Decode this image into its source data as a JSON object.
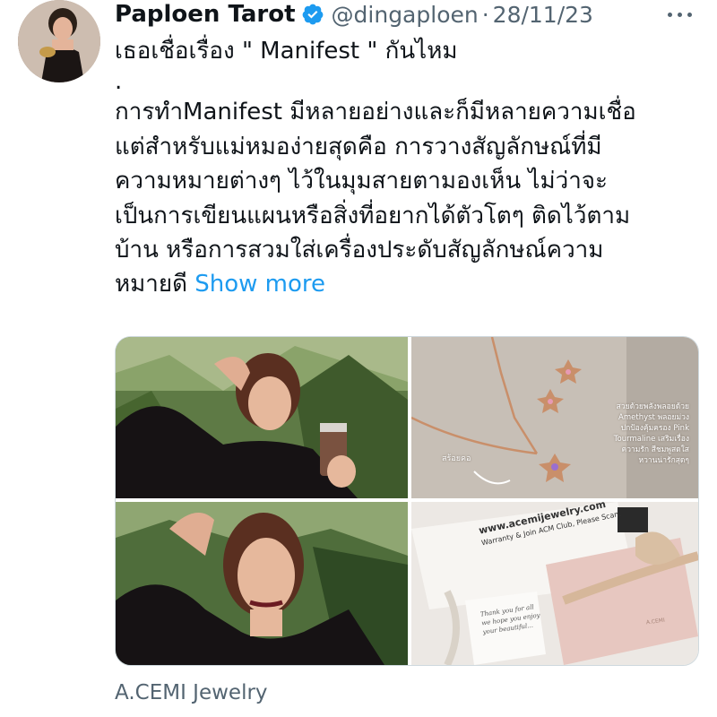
{
  "author": {
    "display_name": "Paploen Tarot",
    "handle": "@dingaploen",
    "separator": "·",
    "date": "28/11/23",
    "verified_icon": "verified-badge-icon",
    "avatar_icon": "profile-avatar"
  },
  "tweet": {
    "lines": [
      "เธอเชื่อเรื่อง \" Manifest \" กันไหม",
      ".",
      "การทำManifest มีหลายอย่างและก็มีหลายความเชื่อ",
      "แต่สำหรับแม่หมอง่ายสุดคือ การวางสัญลักษณ์ที่มี",
      "ความหมายต่างๆ ไว้ในมุมสายตามองเห็น ไม่ว่าจะ",
      "เป็นการเขียนแผนหรือสิ่งที่อยากได้ตัวโตๆ ติดไว้ตาม",
      "บ้าน หรือการสวมใส่เครื่องประดับสัญลักษณ์ความ"
    ],
    "last_line": "หมายดี",
    "show_more": "Show more"
  },
  "media": {
    "photos": [
      "photo-woman-with-drink",
      "photo-necklace-and-earrings",
      "photo-woman-portrait",
      "photo-jewelry-gift-box"
    ],
    "jewelry_overlay_lines": [
      "สวยด้วยพลังพลอยด้วย",
      "Amethyst พลอยม่วง",
      "ปกป้องคุ้มครอง Pink",
      "Tourmaline เสริมเรื่อง",
      "ความรัก สีชมพูสดใส",
      "หวานน่ารักสุดๆ"
    ],
    "overlay_small": "สร้อยคอ",
    "box_card_lines": [
      "www.acemijewelry.com",
      "Warranty & Join ACM Club, Please Scan."
    ],
    "box_brand": "A.CEMI",
    "note_lines": [
      "Thank you for all",
      "we hope you enjoy",
      "your beautiful..."
    ]
  },
  "footer": {
    "caption": "A.CEMI Jewelry"
  }
}
